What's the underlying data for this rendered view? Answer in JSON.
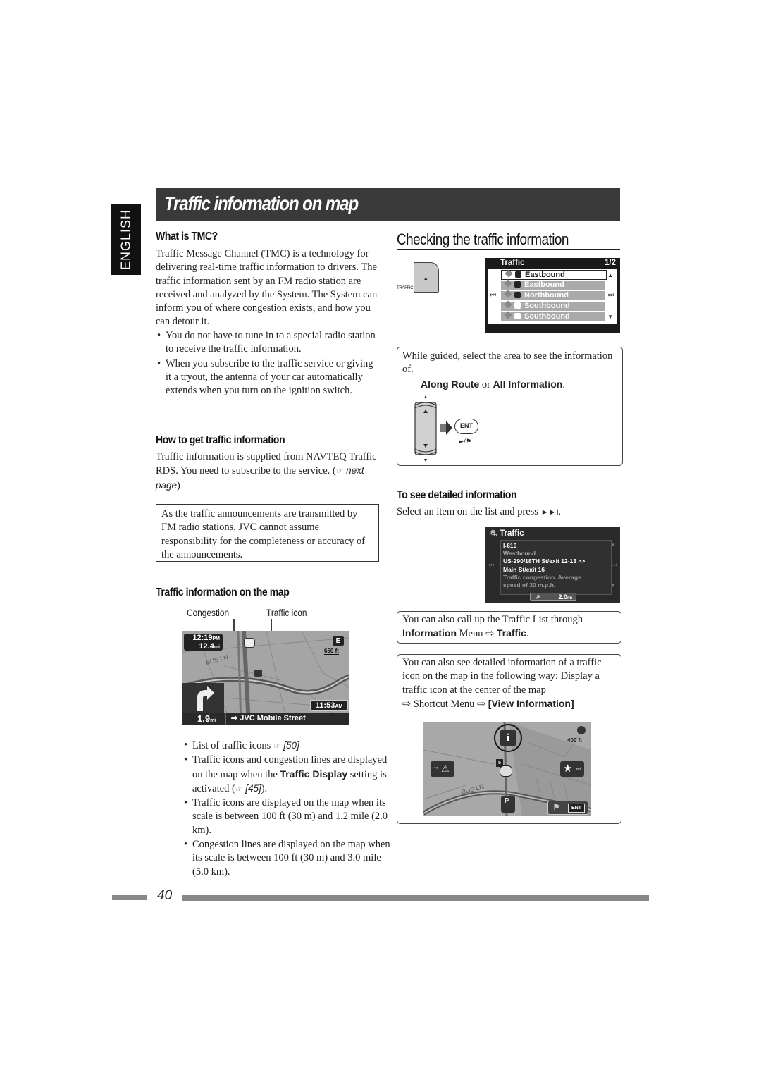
{
  "page": {
    "language_tab": "ENGLISH",
    "title": "Traffic information on map",
    "page_number": "40"
  },
  "left": {
    "what_is_tmc": {
      "heading": "What is TMC?",
      "paragraph": "Traffic Message Channel (TMC) is a technology for delivering real-time traffic information to drivers. The traffic information sent by an FM radio station are received and analyzed by the System. The System can inform you of where congestion exists, and how you can detour it.",
      "bullets": [
        "You do not have to tune in to a special radio station to receive the traffic information.",
        "When you subscribe to the traffic service or giving it a tryout, the antenna of your car automatically extends when you turn on the ignition switch."
      ]
    },
    "how_to_get": {
      "heading": "How to get traffic information",
      "paragraph": "Traffic information is supplied from NAVTEQ Traffic RDS. You need to subscribe to the service. (",
      "ref_icon": "☞",
      "ref_text": "next page",
      "paragraph_end": ")"
    },
    "notice_box": "As the traffic announcements are transmitted by FM radio stations, JVC cannot assume responsibility for the completeness or accuracy of the announcements.",
    "on_the_map": {
      "heading": "Traffic information on the map",
      "callout_congestion": "Congestion",
      "callout_traffic_icon": "Traffic icon",
      "map": {
        "time_left": "12:19",
        "time_left_suffix": "PM",
        "distance_left": "12.4",
        "distance_unit": "mi",
        "compass": "E",
        "scale": "650 ft",
        "street_label": "BUS LN",
        "clock": "11:53",
        "clock_suffix": "AM",
        "turn_distance": "1.9",
        "turn_distance_unit": "mi",
        "next_street": "JVC Mobile Street"
      },
      "bullets": [
        {
          "text": "List of traffic icons ",
          "ref_icon": "☞",
          "ref": "[50]"
        },
        {
          "text_before": "Traffic icons and congestion lines are displayed on the map when the ",
          "bold": "Traffic Display",
          "text_after": " setting is activated (",
          "ref_icon": "☞",
          "ref": "[45]",
          "end": ")."
        },
        {
          "text": "Traffic icons are displayed on the map when its scale is between 100 ft (30 m) and 1.2 mile (2.0 km)."
        },
        {
          "text": "Congestion lines are displayed on the map when its scale is between 100 ft (30 m) and 3.0 mile (5.0 km)."
        }
      ]
    }
  },
  "right": {
    "checking": {
      "heading": "Checking the traffic information",
      "button_label": "TRAFFIC",
      "button_glyph": "-",
      "screen": {
        "title": "Traffic",
        "page": "1/2",
        "rows": [
          {
            "label": "Eastbound",
            "selected": true,
            "shield": "dark"
          },
          {
            "label": "Eastbound",
            "selected": false,
            "shield": "dark"
          },
          {
            "label": "Northbound",
            "selected": false,
            "shield": "dark"
          },
          {
            "label": "Southbound",
            "selected": false,
            "shield": "light"
          },
          {
            "label": "Southbound",
            "selected": false,
            "shield": "light"
          }
        ],
        "prev_glyph": "⏮",
        "next_glyph": "⏭",
        "up_glyph": "▲",
        "down_glyph": "▼"
      }
    },
    "guided_box": {
      "text": "While guided, select the area to see the information of.",
      "option_1": "Along Route",
      "or": " or ",
      "option_2": "All Information",
      "end": ".",
      "ent_label": "ENT",
      "ent_sub": "►/⚑"
    },
    "detailed": {
      "heading": "To see detailed information",
      "text": "Select an item on the list and press ",
      "key_glyph": "►►I",
      "end": ".",
      "screen": {
        "title": "Traffic",
        "lines": [
          {
            "text": "I-610",
            "dim": false
          },
          {
            "text": "Westbound",
            "dim": true
          },
          {
            "text": "US-290/18TH St/exit 12-13 >>",
            "dim": false
          },
          {
            "text": "Main St/exit 16",
            "dim": false
          },
          {
            "text": "Traffic congestion. Average",
            "dim": true
          },
          {
            "text": "speed of 30 m.p.h.",
            "dim": true
          }
        ],
        "distance": "2.0",
        "distance_unit": "mi"
      }
    },
    "list_box": {
      "text": "You can also call up the Traffic List through ",
      "bold_1": "Information",
      "menu": " Menu ",
      "arrow": "⇨",
      "bold_2": "Traffic",
      "end": "."
    },
    "shortcut_box": {
      "text": "You can also see detailed information of a traffic icon on the map in the following way: Display a traffic icon at the center of the map",
      "arrow": "⇨",
      "shortcut": " Shortcut Menu ",
      "bold": "[View Information]",
      "map": {
        "scale": "400 ft",
        "street_label": "BUS LN",
        "route_number": "5",
        "ent_label": "ENT",
        "info_glyph": "i",
        "star_glyph": "★"
      }
    }
  }
}
